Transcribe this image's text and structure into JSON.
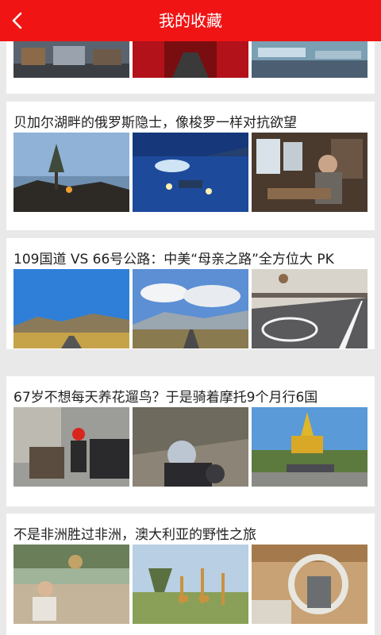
{
  "header": {
    "title": "我的收藏",
    "back_icon": "chevron-left-icon",
    "color": "#f01414"
  },
  "favorites": [
    {
      "title": "",
      "images": [
        "street-scene-photo",
        "red-curtain-stage-photo",
        "train-interior-photo"
      ]
    },
    {
      "title": "贝加尔湖畔的俄罗斯隐士，像梭罗一样对抗欲望",
      "images": [
        "lake-shore-twilight-photo",
        "ice-lake-night-photo",
        "hermit-cabin-interior-photo"
      ]
    },
    {
      "title": "109国道 VS 66号公路：中美“母亲之路”全方位大 PK",
      "images": [
        "plateau-highway-photo",
        "mountain-road-clouds-photo",
        "route-66-sign-road-photo"
      ]
    },
    {
      "title": "67岁不想每天养花遛鸟？于是骑着摩托9个月行6国",
      "images": [
        "motorcyclist-portrait-photo",
        "motorcycle-closeup-photo",
        "golden-pagoda-motorcycles-photo"
      ]
    },
    {
      "title": "不是非洲胜过非洲，澳大利亚的野性之旅",
      "images": [
        "safari-vehicle-cheetah-photo",
        "giraffes-savanna-photo",
        "treehouse-lodge-photo"
      ]
    }
  ]
}
